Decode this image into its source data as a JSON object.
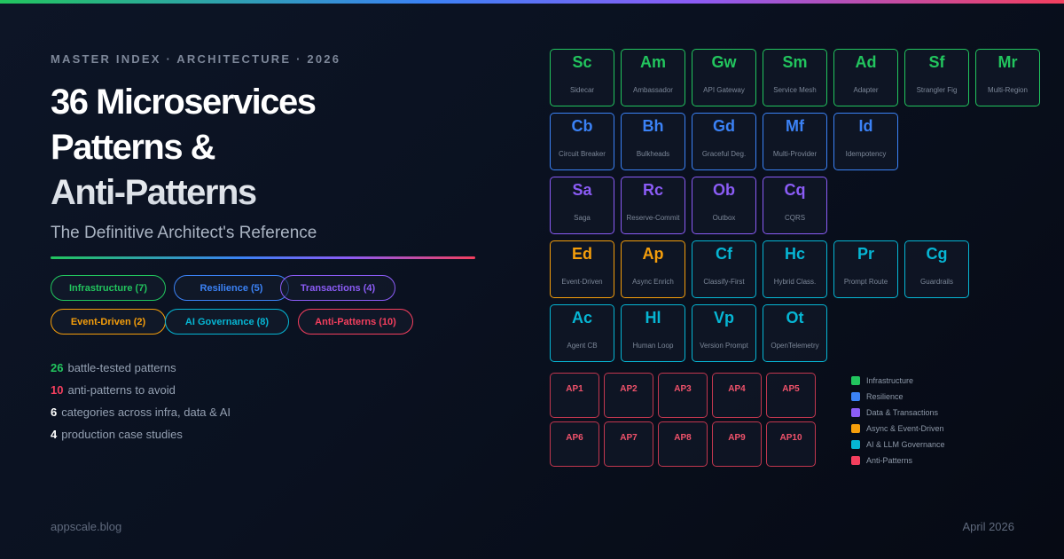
{
  "eyebrow": "MASTER INDEX · ARCHITECTURE · 2026",
  "title_lines": [
    "36 Microservices",
    "Patterns &",
    "Anti-Patterns"
  ],
  "subtitle": "The Definitive Architect's Reference",
  "categories": [
    {
      "label": "Infrastructure (7)",
      "color": "#22c55e"
    },
    {
      "label": "Resilience (5)",
      "color": "#3b82f6"
    },
    {
      "label": "Transactions (4)",
      "color": "#8b5cf6"
    },
    {
      "label": "Event-Driven (2)",
      "color": "#f59e0b"
    },
    {
      "label": "AI Governance (8)",
      "color": "#06b6d4"
    },
    {
      "label": "Anti-Patterns (10)",
      "color": "#f43f5e"
    }
  ],
  "stats": [
    {
      "num": "26",
      "text": "battle-tested patterns",
      "color": "#22c55e"
    },
    {
      "num": "10",
      "text": "anti-patterns to avoid",
      "color": "#f43f5e"
    },
    {
      "num": "6",
      "text": "categories across infra, data & AI",
      "color": "#ffffff"
    },
    {
      "num": "4",
      "text": "production case studies",
      "color": "#ffffff"
    }
  ],
  "tiles": [
    [
      {
        "sym": "Sc",
        "name": "Sidecar",
        "color": "#22c55e"
      },
      {
        "sym": "Am",
        "name": "Ambassador",
        "color": "#22c55e"
      },
      {
        "sym": "Gw",
        "name": "API Gateway",
        "color": "#22c55e"
      },
      {
        "sym": "Sm",
        "name": "Service Mesh",
        "color": "#22c55e"
      },
      {
        "sym": "Ad",
        "name": "Adapter",
        "color": "#22c55e"
      },
      {
        "sym": "Sf",
        "name": "Strangler Fig",
        "color": "#22c55e"
      },
      {
        "sym": "Mr",
        "name": "Multi-Region",
        "color": "#22c55e"
      }
    ],
    [
      {
        "sym": "Cb",
        "name": "Circuit Breaker",
        "color": "#3b82f6"
      },
      {
        "sym": "Bh",
        "name": "Bulkheads",
        "color": "#3b82f6"
      },
      {
        "sym": "Gd",
        "name": "Graceful Deg.",
        "color": "#3b82f6"
      },
      {
        "sym": "Mf",
        "name": "Multi-Provider",
        "color": "#3b82f6"
      },
      {
        "sym": "Id",
        "name": "Idempotency",
        "color": "#3b82f6"
      }
    ],
    [
      {
        "sym": "Sa",
        "name": "Saga",
        "color": "#8b5cf6"
      },
      {
        "sym": "Rc",
        "name": "Reserve-Commit",
        "color": "#8b5cf6"
      },
      {
        "sym": "Ob",
        "name": "Outbox",
        "color": "#8b5cf6"
      },
      {
        "sym": "Cq",
        "name": "CQRS",
        "color": "#8b5cf6"
      }
    ],
    [
      {
        "sym": "Ed",
        "name": "Event-Driven",
        "color": "#f59e0b"
      },
      {
        "sym": "Ap",
        "name": "Async Enrich",
        "color": "#f59e0b"
      },
      {
        "sym": "Cf",
        "name": "Classify-First",
        "color": "#06b6d4"
      },
      {
        "sym": "Hc",
        "name": "Hybrid Class.",
        "color": "#06b6d4"
      },
      {
        "sym": "Pr",
        "name": "Prompt Route",
        "color": "#06b6d4"
      },
      {
        "sym": "Cg",
        "name": "Guardrails",
        "color": "#06b6d4"
      }
    ],
    [
      {
        "sym": "Ac",
        "name": "Agent CB",
        "color": "#06b6d4"
      },
      {
        "sym": "Hl",
        "name": "Human Loop",
        "color": "#06b6d4"
      },
      {
        "sym": "Vp",
        "name": "Version Prompt",
        "color": "#06b6d4"
      },
      {
        "sym": "Ot",
        "name": "OpenTelemetry",
        "color": "#06b6d4"
      }
    ]
  ],
  "anti_patterns": [
    [
      "AP1",
      "AP2",
      "AP3",
      "AP4",
      "AP5"
    ],
    [
      "AP6",
      "AP7",
      "AP8",
      "AP9",
      "AP10"
    ]
  ],
  "legend": [
    {
      "label": "Infrastructure",
      "color": "#22c55e"
    },
    {
      "label": "Resilience",
      "color": "#3b82f6"
    },
    {
      "label": "Data & Transactions",
      "color": "#8b5cf6"
    },
    {
      "label": "Async & Event-Driven",
      "color": "#f59e0b"
    },
    {
      "label": "AI & LLM Governance",
      "color": "#06b6d4"
    },
    {
      "label": "Anti-Patterns",
      "color": "#f43f5e"
    }
  ],
  "footer": {
    "site": "appscale.blog",
    "date": "April 2026"
  }
}
